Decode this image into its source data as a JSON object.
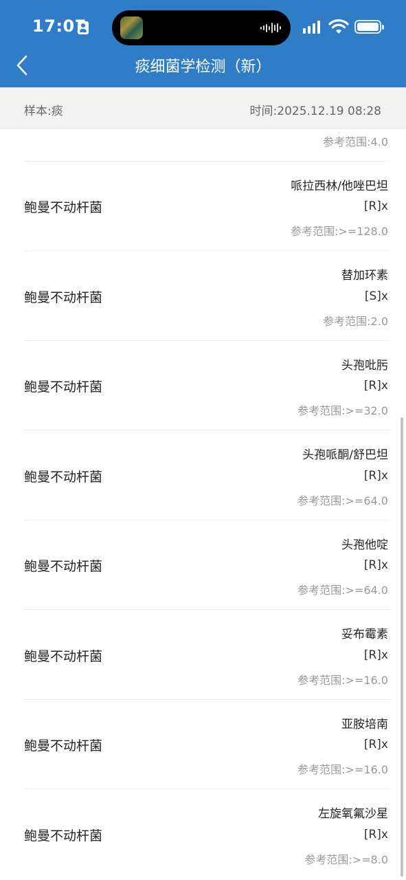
{
  "status_bar": {
    "time": "17:07"
  },
  "nav": {
    "title": "痰细菌学检测（新）"
  },
  "sub_header": {
    "sample": "样本:痰",
    "time": "时间:2025.12.19 08:28"
  },
  "partial_item": {
    "ref": "参考范围:4.0"
  },
  "items": [
    {
      "organism": "鲍曼不动杆菌",
      "drug": "哌拉西林/他唑巴坦",
      "result": "[R]x",
      "ref": "参考范围:>=128.0"
    },
    {
      "organism": "鲍曼不动杆菌",
      "drug": "替加环素",
      "result": "[S]x",
      "ref": "参考范围:2.0"
    },
    {
      "organism": "鲍曼不动杆菌",
      "drug": "头孢吡肟",
      "result": "[R]x",
      "ref": "参考范围:>=32.0"
    },
    {
      "organism": "鲍曼不动杆菌",
      "drug": "头孢哌酮/舒巴坦",
      "result": "[R]x",
      "ref": "参考范围:>=64.0"
    },
    {
      "organism": "鲍曼不动杆菌",
      "drug": "头孢他啶",
      "result": "[R]x",
      "ref": "参考范围:>=64.0"
    },
    {
      "organism": "鲍曼不动杆菌",
      "drug": "妥布霉素",
      "result": "[R]x",
      "ref": "参考范围:>=16.0"
    },
    {
      "organism": "鲍曼不动杆菌",
      "drug": "亚胺培南",
      "result": "[R]x",
      "ref": "参考范围:>=16.0"
    },
    {
      "organism": "鲍曼不动杆菌",
      "drug": "左旋氧氟沙星",
      "result": "[R]x",
      "ref": "参考范围:>=8.0"
    }
  ]
}
